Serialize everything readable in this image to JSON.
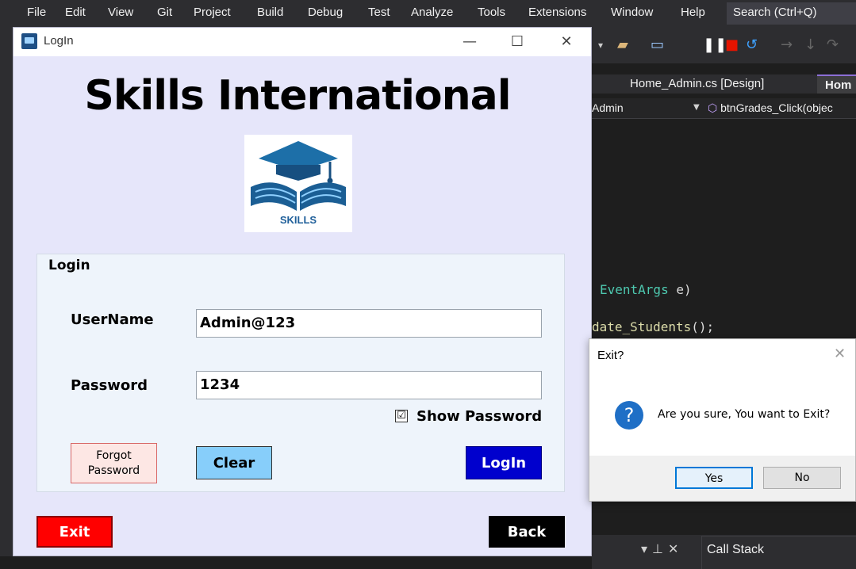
{
  "ide": {
    "menu": [
      "File",
      "Edit",
      "View",
      "Git",
      "Project",
      "Build",
      "Debug",
      "Test",
      "Analyze",
      "Tools",
      "Extensions",
      "Window",
      "Help"
    ],
    "search_placeholder": "Search (Ctrl+Q)",
    "tabs": [
      "Home_Admin.cs [Design]",
      "Hom"
    ],
    "nav_left": "Admin",
    "nav_right": "btnGrades_Click(objec",
    "code_line_1_type": "EventArgs",
    "code_line_1_rest": " e)",
    "code_line_2_fn": "date_Students",
    "code_line_2_rest": "();",
    "panel_title": "Call Stack"
  },
  "login_window": {
    "title": "LogIn",
    "brand": "Skills International",
    "logo_text": "SKILLS",
    "group_title": "Login",
    "username_label": "UserName",
    "username_value": "Admin@123",
    "password_label": "Password",
    "password_value": "1234",
    "show_password_label": "Show Password",
    "show_password_checked": "☑",
    "forgot_label": "Forgot Password",
    "clear_label": "Clear",
    "login_label": "LogIn",
    "exit_label": "Exit",
    "back_label": "Back"
  },
  "exit_dialog": {
    "title": "Exit?",
    "message": "Are you sure, You want to Exit?",
    "yes_label": "Yes",
    "no_label": "No"
  },
  "colors": {
    "login_bg": "#e6e6fa",
    "login_button": "#0000cd",
    "clear_button": "#87cefa",
    "exit_button": "#ff0000",
    "back_button": "#000000",
    "forgot_button": "#fde7e4"
  }
}
